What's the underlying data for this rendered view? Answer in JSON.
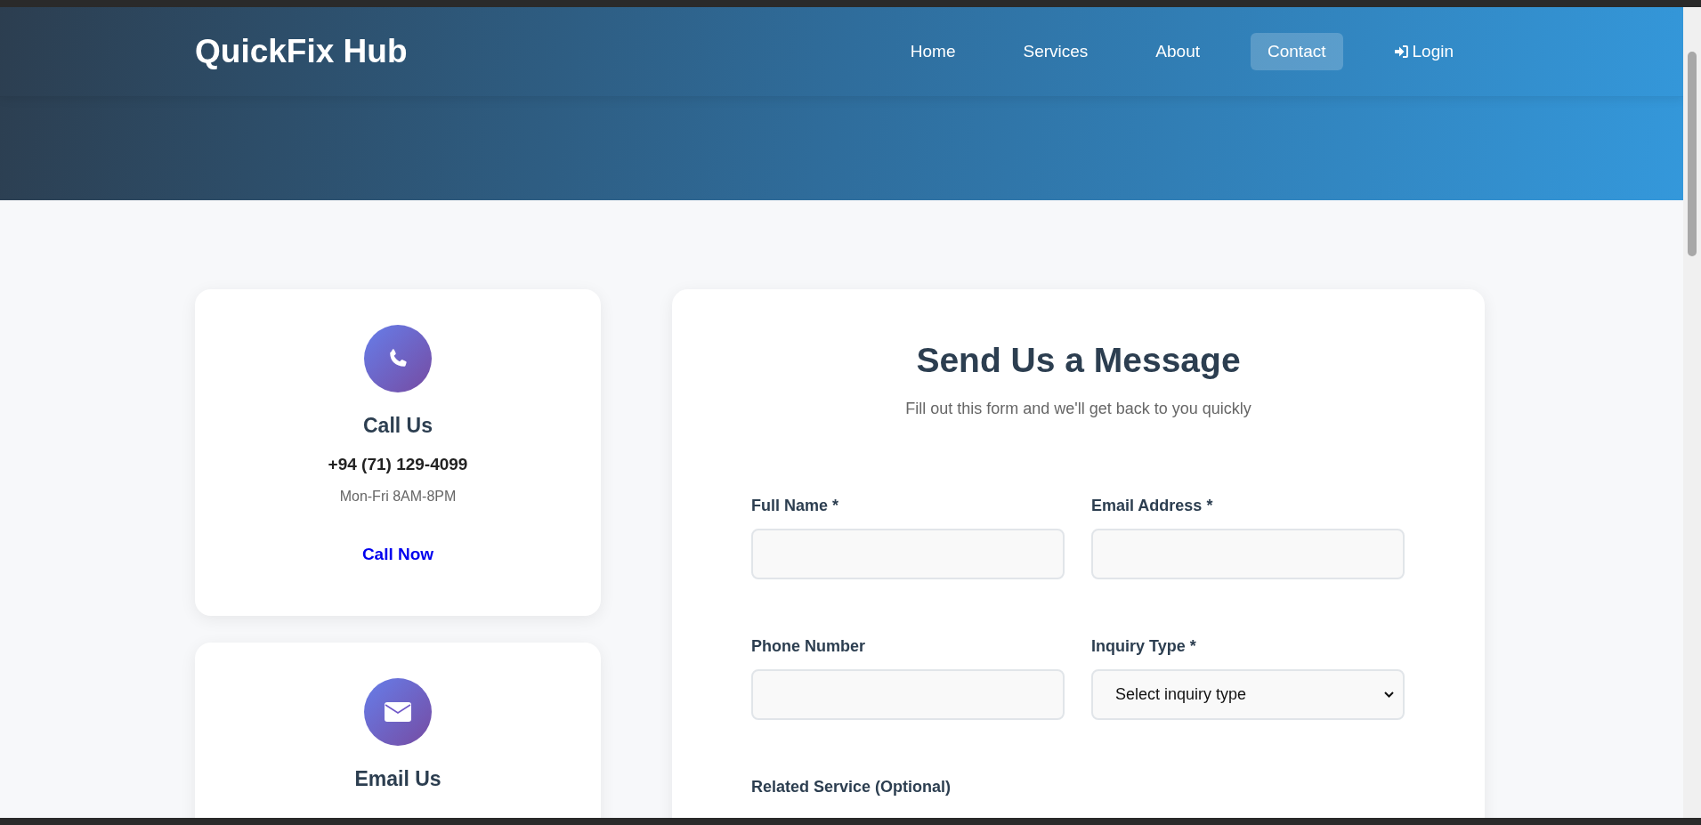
{
  "site": {
    "logo": "QuickFix Hub"
  },
  "nav": [
    {
      "label": "Home",
      "kind": "link",
      "selected": false
    },
    {
      "label": "Services",
      "kind": "link",
      "selected": false
    },
    {
      "label": "About",
      "kind": "link",
      "selected": false
    },
    {
      "label": "Contact",
      "kind": "link",
      "selected": true
    },
    {
      "label": "Login",
      "kind": "login",
      "selected": false
    }
  ],
  "contact_cards": [
    {
      "kind": "phone",
      "title": "Call Us",
      "detail": "+94 (71) 129-4099",
      "note": "Mon-Fri 8AM-8PM",
      "action": "Call Now"
    },
    {
      "kind": "email",
      "title": "Email Us"
    }
  ],
  "form": {
    "title": "Send Us a Message",
    "subtitle": "Fill out this form and we'll get back to you quickly",
    "fields": [
      {
        "kind": "text",
        "label": "Full Name *"
      },
      {
        "kind": "text",
        "label": "Email Address *"
      },
      {
        "kind": "text",
        "label": "Phone Number"
      },
      {
        "kind": "select",
        "label": "Inquiry Type *",
        "value": "Select inquiry type"
      },
      {
        "kind": "label",
        "label": "Related Service (Optional)"
      }
    ]
  }
}
